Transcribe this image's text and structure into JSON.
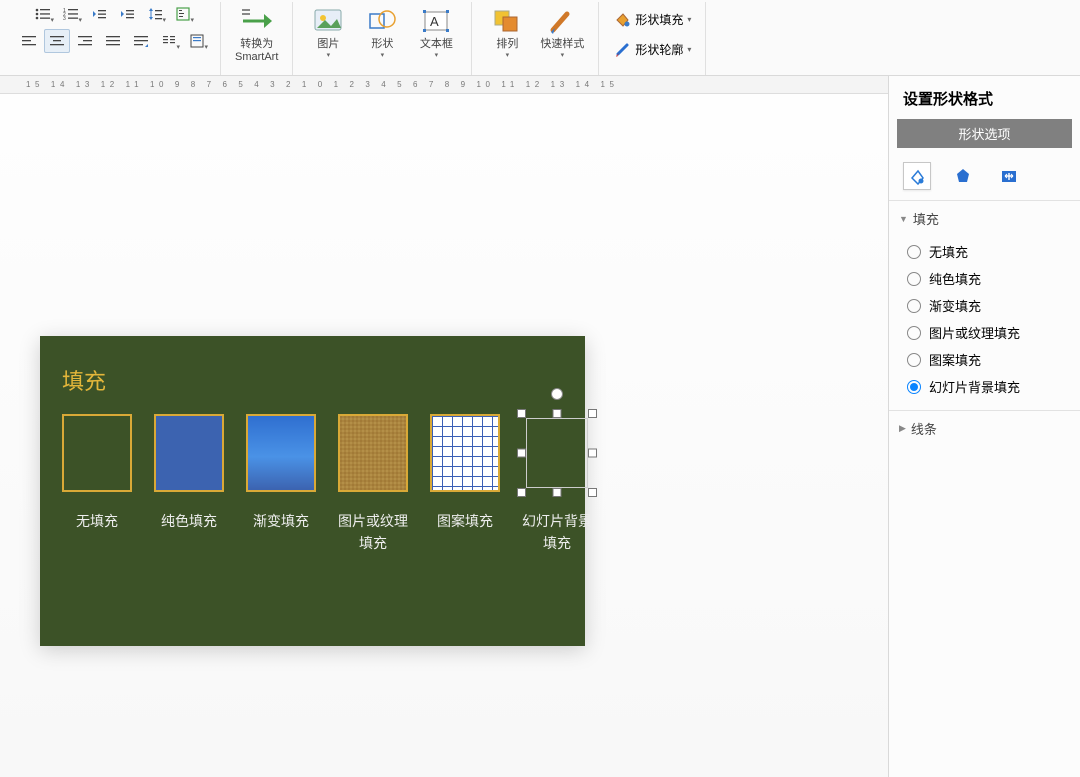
{
  "ribbon": {
    "smartart_label": "转换为\nSmartArt",
    "picture": "图片",
    "shapes": "形状",
    "textbox": "文本框",
    "arrange": "排列",
    "quickstyle": "快速样式",
    "shape_fill": "形状填充",
    "shape_outline": "形状轮廓"
  },
  "ruler": "15 14 13 12 11 10 9  8  7  6  5  4  3  2  1  0  1  2  3  4  5  6  7  8  9 10 11 12 13 14 15",
  "slide": {
    "title": "填充",
    "swatches": [
      "无填充",
      "纯色填充",
      "渐变填充",
      "图片或纹理填充",
      "图案填充",
      "幻灯片背景填充"
    ]
  },
  "panel": {
    "title": "设置形状格式",
    "shape_options": "形状选项",
    "fill_section": "填充",
    "fill_options": [
      "无填充",
      "纯色填充",
      "渐变填充",
      "图片或纹理填充",
      "图案填充",
      "幻灯片背景填充"
    ],
    "fill_selected": 5,
    "line_section": "线条"
  }
}
